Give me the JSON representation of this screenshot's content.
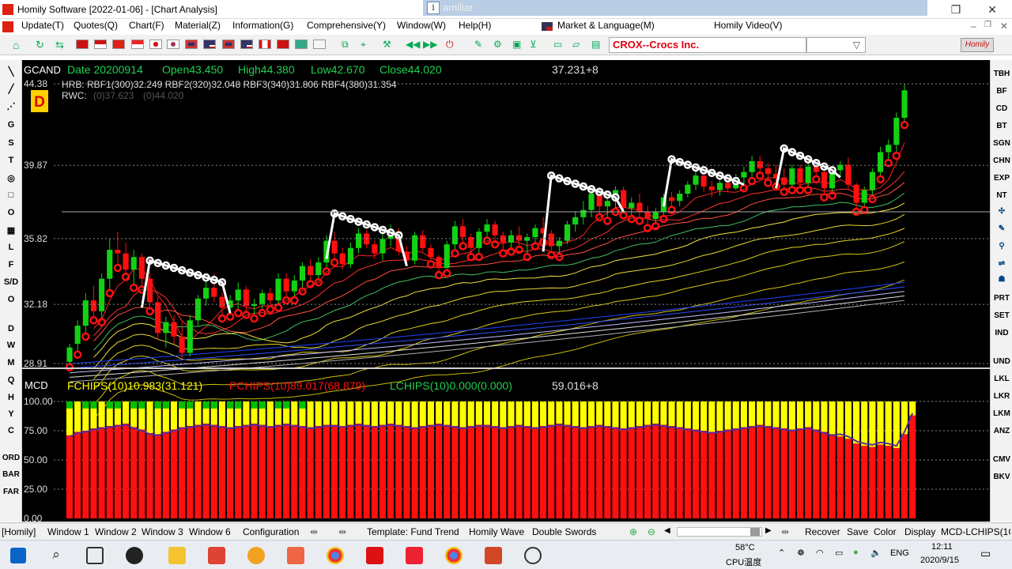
{
  "window": {
    "title": "Homily Software [2022-01-06] - [Chart Analysis]",
    "ime_text": "amiliar"
  },
  "menu": [
    "Update(T)",
    "Quotes(Q)",
    "Chart(F)",
    "Material(Z)",
    "Information(G)",
    "Comprehensive(Y)",
    "Window(W)",
    "Help(H)",
    "Market & Language(M)",
    "Homily Video(V)"
  ],
  "toolbar": {
    "stock": "CROX--Crocs Inc.",
    "logo": "Homily"
  },
  "leftbar": [
    "G",
    "S",
    "T",
    "O",
    "L",
    "F",
    "S/D",
    "O",
    "D",
    "W",
    "M",
    "Q",
    "H",
    "Y",
    "C",
    "ORD",
    "BAR",
    "FAR"
  ],
  "rightbar": [
    "TBH",
    "BF",
    "CD",
    "BT",
    "SGN",
    "CHN",
    "EXP",
    "NT",
    "PRT",
    "SET",
    "IND",
    "UND",
    "LKL",
    "LKR",
    "LKM",
    "ANZ",
    "CMV",
    "BKV"
  ],
  "chart": {
    "symbol": "GCAND",
    "period": "D",
    "info": {
      "date": "Date 20200914",
      "open": "Open43.450",
      "high": "High44.380",
      "low": "Low42.670",
      "close": "Close44.020"
    },
    "volume_readout": "37.231+8",
    "hrb": "HRB: RBF1(300)32.249  RBF2(320)32.048  RBF3(340)31.806  RBF4(380)31.354",
    "rwc_label": "RWC:",
    "rwc_v1": "(0)37.623",
    "rwc_v2": "(0)44.020",
    "price_ticks": [
      "44.38",
      "39.87",
      "35.82",
      "32.18",
      "28.91"
    ],
    "sub_title": "MCD",
    "fchips": "FCHIPS(10)10.983(31.121)",
    "pchips": "PCHIPS(10)89.017(68.879)",
    "lchips": "LCHIPS(10)0.000(0.000)",
    "sub_readout": "59.016+8",
    "sub_ticks": [
      "100.00",
      "75.00",
      "50.00",
      "25.00",
      "0.00"
    ],
    "colors": {
      "up": "#12d212",
      "down": "#ff1010",
      "flat": "#ffff00",
      "cyan": "#20d050",
      "yellow_text": "#ffff00"
    }
  },
  "chart_data": {
    "type": "candlestick",
    "candles_ohlc": [
      [
        29,
        30,
        28.9,
        29.8
      ],
      [
        30,
        31.3,
        29.6,
        31
      ],
      [
        31,
        32.8,
        30.6,
        32.4
      ],
      [
        32.4,
        33.2,
        31.5,
        31.8
      ],
      [
        31.8,
        33.9,
        31.4,
        33.6
      ],
      [
        33.6,
        35.8,
        33,
        35.2
      ],
      [
        35.2,
        36.2,
        34.4,
        35
      ],
      [
        35,
        35.6,
        33.9,
        34.1
      ],
      [
        34.1,
        35.2,
        33.3,
        34.8
      ],
      [
        34.8,
        35,
        33.2,
        33.6
      ],
      [
        33.6,
        34,
        32,
        32.3
      ],
      [
        32.3,
        32.6,
        30.2,
        30.6
      ],
      [
        30.6,
        31.5,
        29.8,
        31.2
      ],
      [
        31.2,
        31.6,
        30,
        30.4
      ],
      [
        30.4,
        31.2,
        29.2,
        29.5
      ],
      [
        29.5,
        31.6,
        29.3,
        31.3
      ],
      [
        31.3,
        32.7,
        31,
        32.5
      ],
      [
        32.5,
        33.6,
        32.1,
        33.1
      ],
      [
        33.1,
        33.9,
        32.3,
        32.6
      ],
      [
        32.6,
        32.8,
        31.6,
        32
      ],
      [
        32,
        32.7,
        31.7,
        32.4
      ],
      [
        32.4,
        33.4,
        31.9,
        33
      ],
      [
        33,
        33.2,
        31.8,
        32.1
      ],
      [
        32.1,
        32.5,
        31.6,
        32.2
      ],
      [
        32.2,
        33,
        31.9,
        32.8
      ],
      [
        32.8,
        33.1,
        32.1,
        32.4
      ],
      [
        32.4,
        33.9,
        32.2,
        33.6
      ],
      [
        33.6,
        33.9,
        32.6,
        32.9
      ],
      [
        32.9,
        33.8,
        32.6,
        33.5
      ],
      [
        33.5,
        34.5,
        33.1,
        34.3
      ],
      [
        34.3,
        34.7,
        33.5,
        33.8
      ],
      [
        33.8,
        34.8,
        33.6,
        34.5
      ],
      [
        34.5,
        36,
        34.2,
        35.7
      ],
      [
        35.7,
        36.2,
        34.7,
        35
      ],
      [
        35,
        35.3,
        34.1,
        34.4
      ],
      [
        34.4,
        35.6,
        34.2,
        35.3
      ],
      [
        35.3,
        36.4,
        35,
        36.1
      ],
      [
        36.1,
        36.3,
        35.3,
        35.5
      ],
      [
        35.5,
        35.7,
        34.7,
        35
      ],
      [
        35,
        36.1,
        34.6,
        35.8
      ],
      [
        35.8,
        36.6,
        35.4,
        36.2
      ],
      [
        36.2,
        36.4,
        34.9,
        35.1
      ],
      [
        35.1,
        35.4,
        34.3,
        34.6
      ],
      [
        34.6,
        36.2,
        34.4,
        36
      ],
      [
        36,
        36.3,
        35.1,
        35.3
      ],
      [
        35.3,
        35.5,
        34.6,
        34.8
      ],
      [
        34.8,
        34.9,
        34,
        34.2
      ],
      [
        34.2,
        35.7,
        34.1,
        35.5
      ],
      [
        35.5,
        36.8,
        35.2,
        36.5
      ],
      [
        36.5,
        36.9,
        35.6,
        35.9
      ],
      [
        35.9,
        36.1,
        35,
        35.3
      ],
      [
        35.3,
        36.4,
        35,
        36.2
      ],
      [
        36.2,
        36.9,
        35.9,
        36.6
      ],
      [
        36.6,
        36.8,
        35.7,
        36
      ],
      [
        36,
        36.2,
        35.2,
        35.6
      ],
      [
        35.6,
        36.3,
        35.3,
        36
      ],
      [
        36,
        36.5,
        35.4,
        35.7
      ],
      [
        35.7,
        36.1,
        35,
        35.9
      ],
      [
        35.9,
        36.6,
        35.6,
        36.4
      ],
      [
        36.4,
        37,
        35.8,
        36.1
      ],
      [
        36.1,
        36.3,
        35.1,
        35.4
      ],
      [
        35.4,
        35.9,
        35,
        35.7
      ],
      [
        35.7,
        36.8,
        35.5,
        36.6
      ],
      [
        36.6,
        37.3,
        36.2,
        37
      ],
      [
        37,
        37.9,
        36.6,
        37.4
      ],
      [
        37.4,
        38.6,
        37,
        38.3
      ],
      [
        38.3,
        38.7,
        37.2,
        37.6
      ],
      [
        37.6,
        38.2,
        37,
        37.9
      ],
      [
        37.9,
        38.7,
        37.5,
        38.5
      ],
      [
        38.5,
        38.7,
        37.3,
        37.5
      ],
      [
        37.5,
        38.1,
        37.1,
        37.8
      ],
      [
        37.8,
        38.3,
        37,
        37.3
      ],
      [
        37.3,
        37.6,
        36.6,
        36.9
      ],
      [
        36.9,
        37.5,
        36.7,
        37.3
      ],
      [
        37.3,
        38.3,
        37.1,
        38.1
      ],
      [
        38.1,
        38.4,
        37.6,
        37.9
      ],
      [
        37.9,
        38.5,
        37.6,
        38.3
      ],
      [
        38.3,
        39,
        38.1,
        38.8
      ],
      [
        38.8,
        39.6,
        38.5,
        39.3
      ],
      [
        39.3,
        39.6,
        38.4,
        38.7
      ],
      [
        38.7,
        39,
        38.1,
        38.5
      ],
      [
        38.5,
        39.2,
        38.2,
        38.9
      ],
      [
        38.9,
        39.4,
        38.4,
        38.6
      ],
      [
        38.6,
        39.4,
        38.5,
        39.2
      ],
      [
        39.2,
        39.8,
        38.8,
        39.5
      ],
      [
        39.5,
        40.4,
        39.2,
        40.1
      ],
      [
        40.1,
        40.4,
        39.5,
        39.7
      ],
      [
        39.7,
        40,
        39.1,
        39.4
      ],
      [
        39.4,
        39.9,
        38.9,
        39.2
      ],
      [
        39.2,
        39.7,
        38.6,
        38.8
      ],
      [
        38.8,
        39.9,
        38.7,
        39.7
      ],
      [
        39.7,
        39.9,
        38.7,
        38.9
      ],
      [
        38.9,
        40,
        38.7,
        39.8
      ],
      [
        39.8,
        40.2,
        39.3,
        39.5
      ],
      [
        39.5,
        39.8,
        38.3,
        38.6
      ],
      [
        38.6,
        39.8,
        38.4,
        39.6
      ],
      [
        39.6,
        40.1,
        39.2,
        39.9
      ],
      [
        39.9,
        40.3,
        38.5,
        38.8
      ],
      [
        38.8,
        38.9,
        37.5,
        37.8
      ],
      [
        37.8,
        38.7,
        37.6,
        38.5
      ],
      [
        38.5,
        39.7,
        38.2,
        39.5
      ],
      [
        39.5,
        40.9,
        39.3,
        40.6
      ],
      [
        40.6,
        41.3,
        40.2,
        41
      ],
      [
        41,
        42.8,
        40.6,
        42.5
      ],
      [
        42.5,
        44.38,
        42.3,
        44.02
      ]
    ],
    "price_axis": {
      "ticks": [
        44.38,
        39.87,
        35.82,
        32.18,
        28.91
      ],
      "range": [
        28.91,
        44.38
      ]
    },
    "indicators": {
      "HRB": {
        "RBF1(300)": 32.249,
        "RBF2(320)": 32.048,
        "RBF3(340)": 31.806,
        "RBF4(380)": 31.354
      },
      "RWC": [
        37.623,
        44.02
      ]
    },
    "sub_chart": {
      "name": "MCD",
      "ylim": [
        0,
        100
      ],
      "ticks": [
        100,
        75,
        50,
        25,
        0
      ],
      "series": [
        {
          "name": "FCHIPS(10)",
          "last": 10.983,
          "prev": 31.121,
          "color": "#ffff00"
        },
        {
          "name": "PCHIPS(10)",
          "last": 89.017,
          "prev": 68.879,
          "color": "#ff1010"
        },
        {
          "name": "LCHIPS(10)",
          "last": 0.0,
          "prev": 0.0,
          "color": "#00c000"
        }
      ],
      "red_share": [
        71,
        74,
        75,
        77,
        78,
        79,
        80,
        81,
        78,
        76,
        73,
        72,
        74,
        76,
        78,
        79,
        80,
        81,
        80,
        79,
        78,
        79,
        80,
        81,
        80,
        79,
        80,
        81,
        80,
        79,
        78,
        79,
        80,
        80,
        79,
        80,
        81,
        80,
        79,
        80,
        81,
        80,
        79,
        78,
        79,
        80,
        81,
        80,
        79,
        78,
        79,
        80,
        80,
        79,
        78,
        79,
        80,
        79,
        78,
        79,
        80,
        81,
        80,
        79,
        78,
        79,
        80,
        79,
        78,
        77,
        78,
        79,
        80,
        81,
        80,
        79,
        78,
        77,
        76,
        75,
        74,
        75,
        76,
        77,
        78,
        79,
        80,
        79,
        78,
        77,
        76,
        77,
        78,
        76,
        74,
        72,
        70,
        68,
        64,
        62,
        61,
        63,
        62,
        60,
        72,
        88
      ]
    }
  },
  "statusbar": {
    "brand": "[Homily]",
    "windows": [
      "Window 1",
      "Window 2",
      "Window 3",
      "Window 6"
    ],
    "config": "Configuration",
    "template": "Template: Fund Trend",
    "wave": "Homily Wave",
    "swords": "Double Swords",
    "recover": "Recover",
    "save": "Save",
    "color": "Color",
    "display": "Display",
    "indicator": "MCD-LCHIPS(1C"
  },
  "taskbar": {
    "temp": "58°C",
    "cpu": "CPU温度",
    "lang": "ENG",
    "time": "12:11",
    "date": "2020/9/15"
  }
}
